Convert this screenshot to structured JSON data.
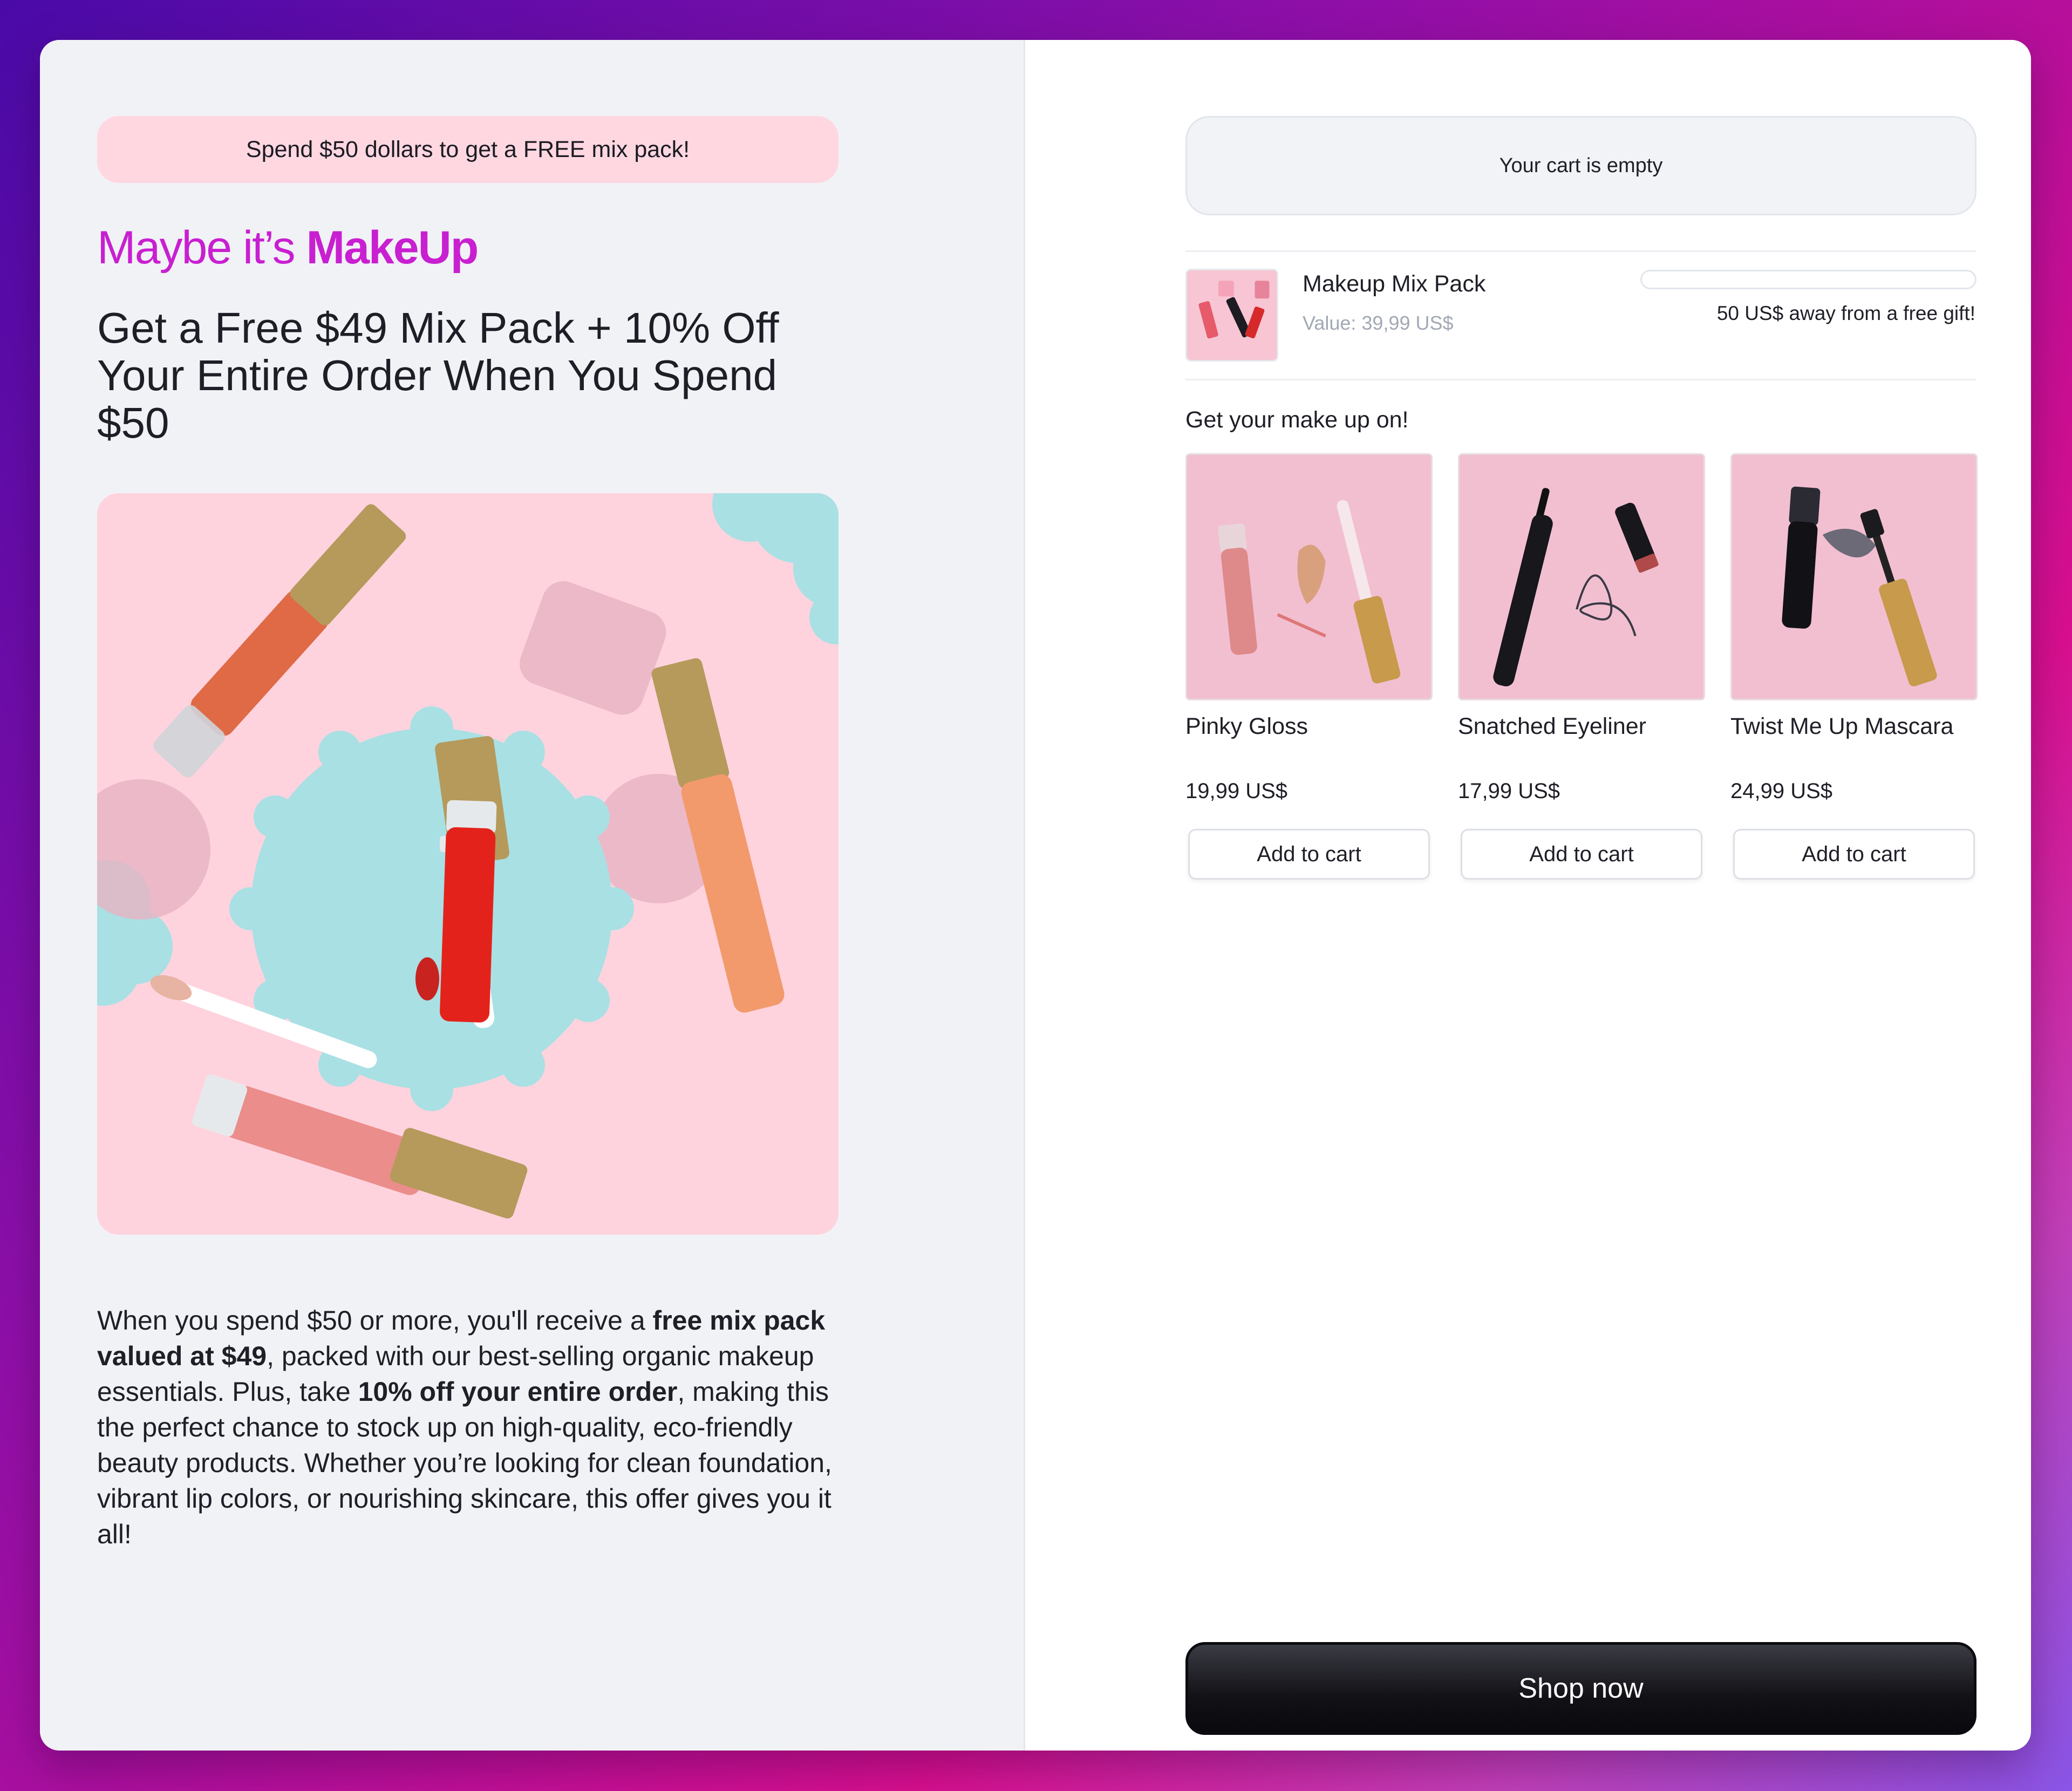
{
  "promo_banner": "Spend $50 dollars to get a FREE mix pack!",
  "brand": {
    "prefix": "Maybe it’s ",
    "highlight": "MakeUp"
  },
  "headline": "Get a Free $49 Mix Pack + 10% Off Your Entire Order When You Spend $50",
  "description": {
    "p1": "When you spend $50 or more, you'll receive a ",
    "b1": "free mix pack valued at $49",
    "p2": ", packed with our best-selling organic makeup essentials. Plus, take ",
    "b2": "10% off your entire order",
    "p3": ", making this the perfect chance to stock up on high-quality, eco-friendly beauty products. Whether you’re looking for clean foundation, vibrant lip colors, or nourishing skincare, this offer gives you it all!"
  },
  "cart": {
    "empty_message": "Your cart is empty",
    "gift": {
      "name": "Makeup Mix Pack",
      "value": "Value: 39,99 US$",
      "progress_text": "50 US$ away from a free gift!",
      "progress_fraction": 0
    },
    "section_title": "Get your make up on!",
    "products": [
      {
        "name": "Pinky Gloss",
        "price": "19,99 US$",
        "button": "Add to cart"
      },
      {
        "name": "Snatched Eyeliner",
        "price": "17,99 US$",
        "button": "Add to cart"
      },
      {
        "name": "Twist Me Up Mascara",
        "price": "24,99 US$",
        "button": "Add to cart"
      }
    ],
    "shop_button": "Shop now"
  },
  "colors": {
    "brand": "#c81fd0",
    "promo_bg": "#ffd7e1",
    "hero_bg": "#ffd3de",
    "accent_teal": "#a9e0e4",
    "cap_gold": "#b59a5c",
    "cta": "#111116"
  }
}
